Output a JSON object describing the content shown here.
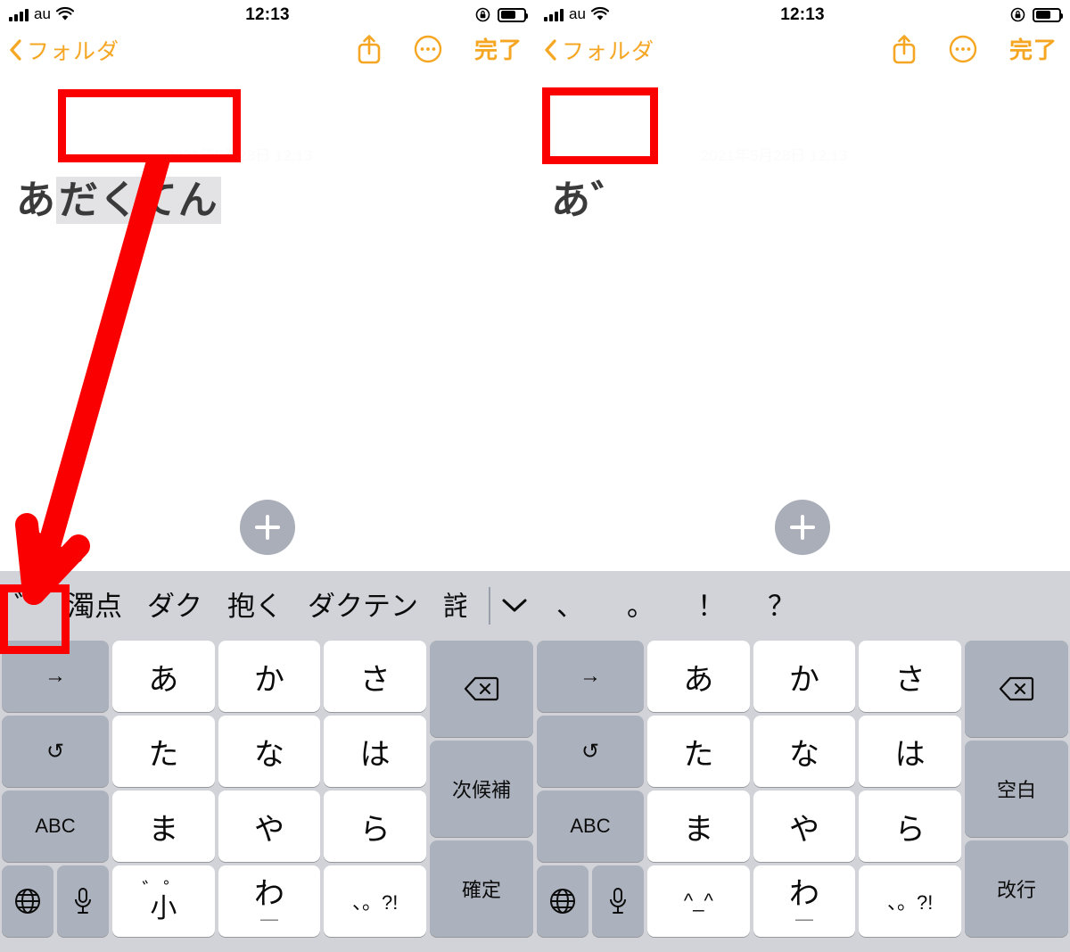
{
  "colors": {
    "accent": "#F5A623",
    "annotation": "#FA0000",
    "keyboard_bg": "#D1D3D9",
    "key_white": "#FFFFFF",
    "key_gray": "#ACB2BD",
    "marked_text_bg": "#E3E3E5",
    "add_button_bg": "#A9AEB8"
  },
  "panels": [
    {
      "id": "left",
      "status_bar": {
        "carrier": "au",
        "time": "12:13",
        "signal_icon": "signal-bars-icon",
        "wifi_icon": "wifi-icon",
        "rotation_lock_icon": "rotation-lock-icon",
        "battery_icon": "battery-icon",
        "battery_level_pct": 58
      },
      "nav": {
        "back_label": "フォルダ",
        "back_icon": "chevron-left-icon",
        "share_icon": "share-icon",
        "more_icon": "more-ellipsis-icon",
        "done_label": "完了"
      },
      "note": {
        "date": "2021年5月28日 12:13",
        "text_plain": "あ",
        "text_marked": "だくてん",
        "add_button_icon": "plus-icon"
      },
      "keyboard": {
        "suggestions": [
          "゛",
          "濁点",
          "ダク",
          "抱く",
          "ダクテン",
          "詫"
        ],
        "expand_icon": "chevron-down-icon",
        "keys": {
          "fn_col": [
            "→",
            "↺",
            "ABC"
          ],
          "globe_icon": "globe-icon",
          "mic_icon": "microphone-icon",
          "kana": [
            "あ",
            "か",
            "さ",
            "た",
            "な",
            "は",
            "ま",
            "や",
            "ら"
          ],
          "dakuten_marks": "゛゜",
          "dakuten_sho": "小",
          "wa_key": "わ",
          "wa_underscore": "＿",
          "punct_key": "、。?!",
          "delete_icon": "delete-backspace-icon",
          "next_candidate": "次候補",
          "confirm": "確定"
        }
      }
    },
    {
      "id": "right",
      "status_bar": {
        "carrier": "au",
        "time": "12:13",
        "signal_icon": "signal-bars-icon",
        "wifi_icon": "wifi-icon",
        "rotation_lock_icon": "rotation-lock-icon",
        "battery_icon": "battery-icon",
        "battery_level_pct": 58
      },
      "nav": {
        "back_label": "フォルダ",
        "back_icon": "chevron-left-icon",
        "share_icon": "share-icon",
        "more_icon": "more-ellipsis-icon",
        "done_label": "完了"
      },
      "note": {
        "date": "2021年5月28日 12:13",
        "text_plain": "あ゛",
        "text_marked": "",
        "add_button_icon": "plus-icon"
      },
      "keyboard": {
        "suggestions": [
          "、",
          "。",
          "！",
          "？"
        ],
        "keys": {
          "fn_col": [
            "→",
            "↺",
            "ABC"
          ],
          "globe_icon": "globe-icon",
          "mic_icon": "microphone-icon",
          "kana": [
            "あ",
            "か",
            "さ",
            "た",
            "な",
            "は",
            "ま",
            "や",
            "ら"
          ],
          "kaomoji_key": "^_^",
          "wa_key": "わ",
          "wa_underscore": "＿",
          "punct_key": "、。?!",
          "delete_icon": "delete-backspace-icon",
          "space": "空白",
          "newline": "改行"
        }
      }
    }
  ],
  "annotations": {
    "arrow_icon": "red-arrow-icon",
    "box_icon": "red-highlight-box"
  }
}
